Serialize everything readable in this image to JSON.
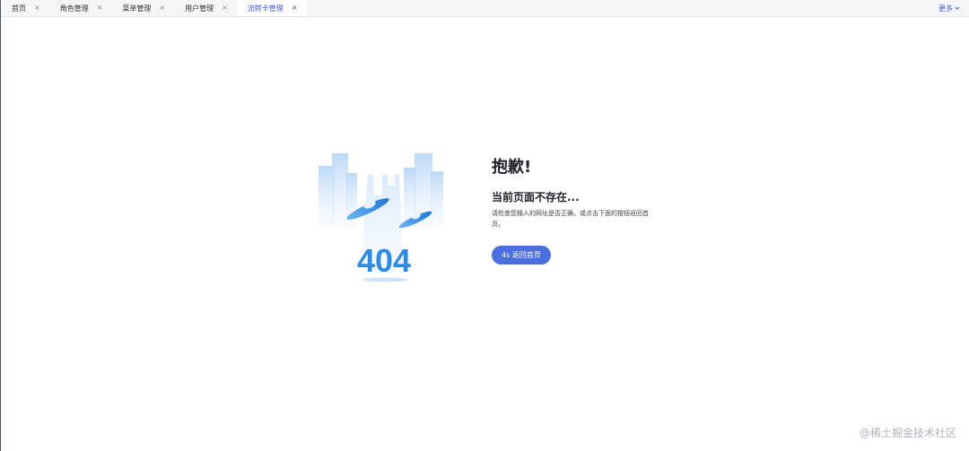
{
  "tabs": [
    {
      "label": "首页",
      "active": false
    },
    {
      "label": "角色管理",
      "active": false
    },
    {
      "label": "菜单管理",
      "active": false
    },
    {
      "label": "用户管理",
      "active": false
    },
    {
      "label": "流转卡管理",
      "active": true
    }
  ],
  "tab_close_glyph": "×",
  "more_label": "更多",
  "error": {
    "code": "404",
    "title": "抱歉!",
    "subtitle": "当前页面不存在...",
    "description": "请检查您输入的网址是否正确，或点击下面的按钮返回首页。",
    "back_button": "4s 返回首页"
  },
  "watermark": "@稀土掘金技术社区",
  "colors": {
    "accent": "#3b5bdb",
    "button": "#4c6fe0",
    "illustration_blue": "#2f8ce6"
  }
}
